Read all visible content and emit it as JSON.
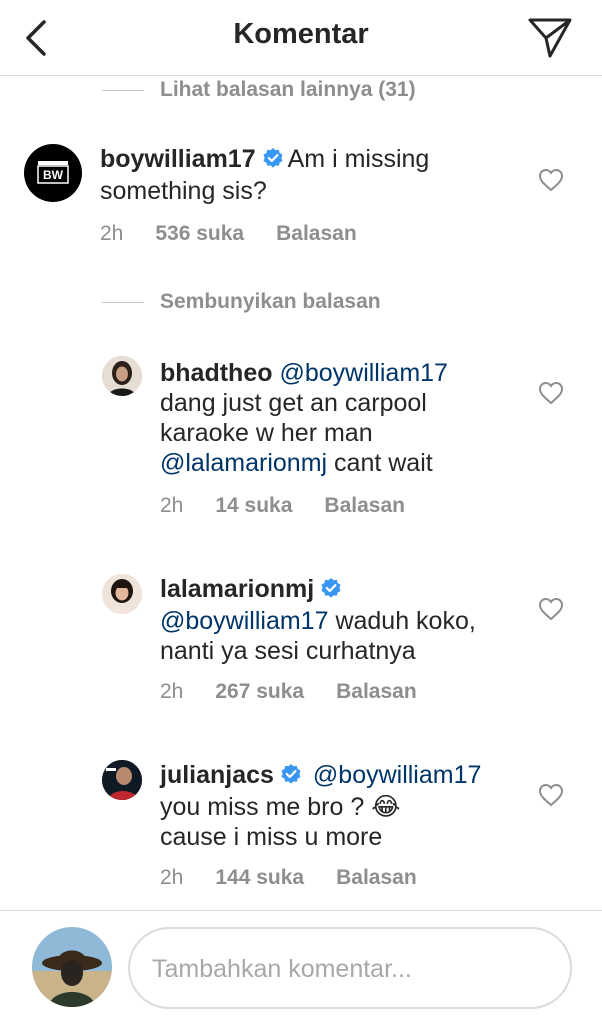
{
  "header": {
    "title": "Komentar"
  },
  "thread": {
    "more_replies": "Lihat balasan lainnya (31)",
    "hide_replies": "Sembunyikan balasan"
  },
  "comments": [
    {
      "username": "boywilliam17",
      "verified": true,
      "text_1": "Am i missing",
      "text_2": "something sis?",
      "time": "2h",
      "likes": "536 suka",
      "reply": "Balasan"
    },
    {
      "username": "bhadtheo",
      "verified": false,
      "mention": "@boywilliam17",
      "text_1": "dang just get an carpool",
      "text_2": "karaoke w her man",
      "mention_2": "@lalamarionmj",
      "text_3": " cant wait",
      "time": "2h",
      "likes": "14 suka",
      "reply": "Balasan"
    },
    {
      "username": "lalamarionmj",
      "verified": true,
      "mention": "@boywilliam17",
      "text_1": " waduh koko,",
      "text_2": "nanti ya sesi curhatnya",
      "time": "2h",
      "likes": "267 suka",
      "reply": "Balasan"
    },
    {
      "username": "julianjacs",
      "verified": true,
      "mention": "@boywilliam17",
      "text_1": "you miss me bro ?",
      "emoji": "😂",
      "text_2": "cause i miss u more",
      "time": "2h",
      "likes": "144 suka",
      "reply": "Balasan"
    }
  ],
  "composer": {
    "placeholder": "Tambahkan komentar..."
  },
  "colors": {
    "verified": "#3897f0",
    "mention": "#003569",
    "muted": "#8e8e8e",
    "border": "#dbdbdb"
  }
}
